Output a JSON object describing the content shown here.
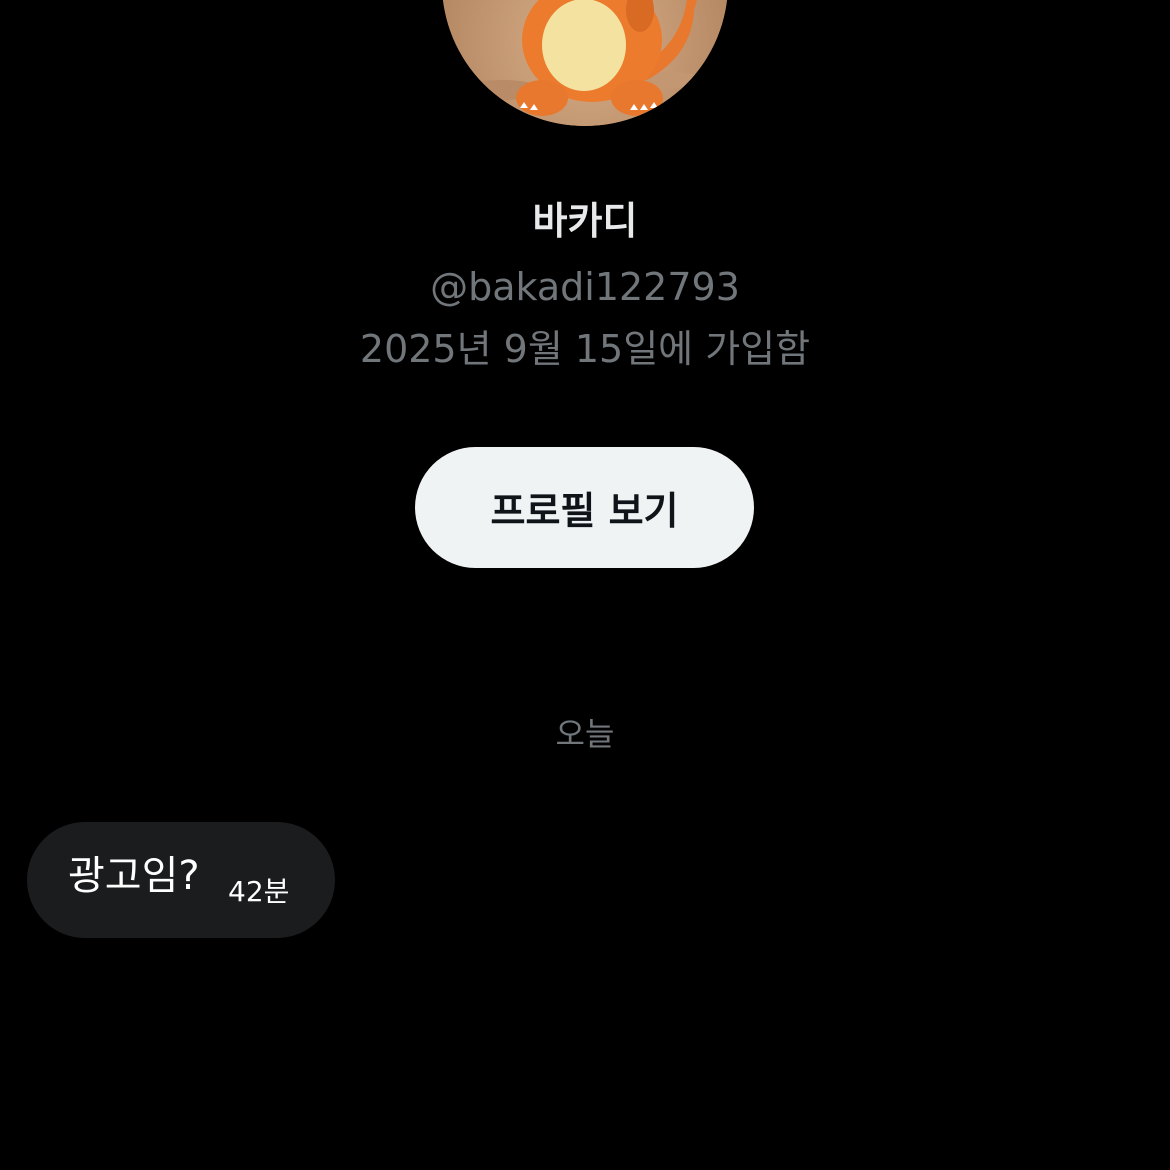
{
  "profile": {
    "avatar_icon": "charmander-avatar",
    "display_name": "바카디",
    "handle": "@bakadi122793",
    "joined": "2025년 9월 15일에 가입함",
    "view_profile_label": "프로필 보기"
  },
  "conversation": {
    "date_divider": "오늘",
    "messages": [
      {
        "text": "광고임?",
        "time": "42분"
      }
    ]
  },
  "colors": {
    "background": "#000000",
    "primary_text": "#e7e9ea",
    "secondary_text": "#71767b",
    "button_bg": "#eff3f4",
    "bubble_bg": "#1b1c1e"
  }
}
